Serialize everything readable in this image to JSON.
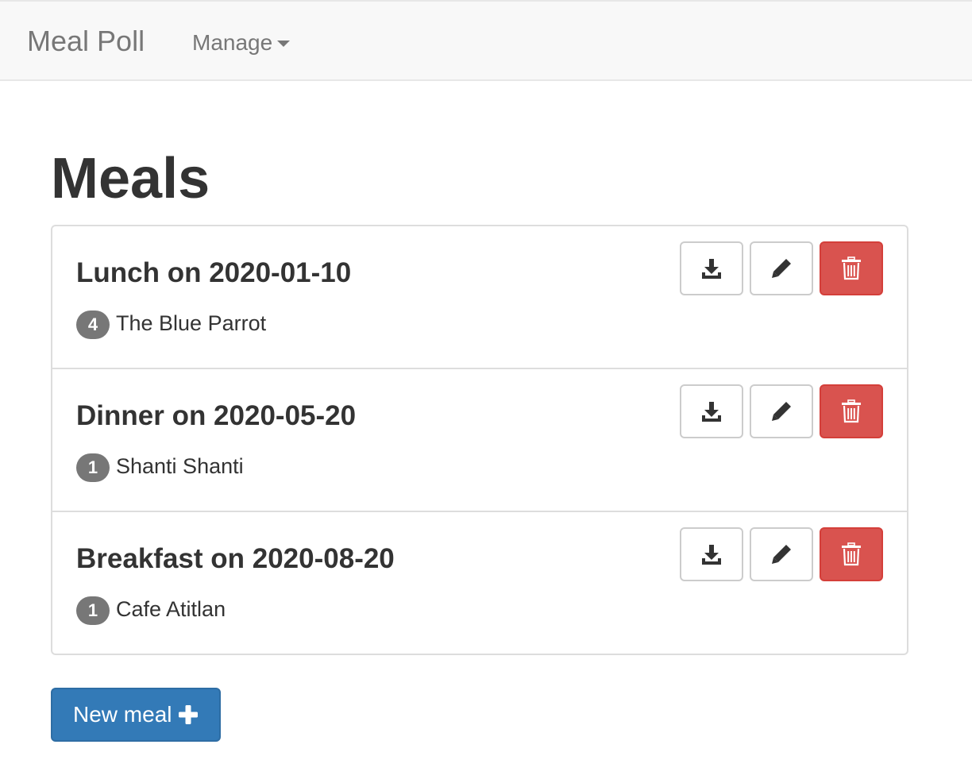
{
  "navbar": {
    "brand": "Meal Poll",
    "menu_label": "Manage"
  },
  "page": {
    "title": "Meals"
  },
  "meals": [
    {
      "title": "Lunch on 2020-01-10",
      "count": "4",
      "restaurant": "The Blue Parrot"
    },
    {
      "title": "Dinner on 2020-05-20",
      "count": "1",
      "restaurant": "Shanti Shanti"
    },
    {
      "title": "Breakfast on 2020-08-20",
      "count": "1",
      "restaurant": "Cafe Atitlan"
    }
  ],
  "actions": {
    "new_meal_label": "New meal"
  },
  "icons": {
    "download": "download-icon",
    "edit": "pencil-icon",
    "delete": "trash-icon",
    "add": "plus-icon",
    "menu": "chevron-down-icon"
  },
  "colors": {
    "primary": "#337ab7",
    "danger": "#d9534f",
    "badge": "#777777",
    "navbar": "#f8f8f8"
  }
}
